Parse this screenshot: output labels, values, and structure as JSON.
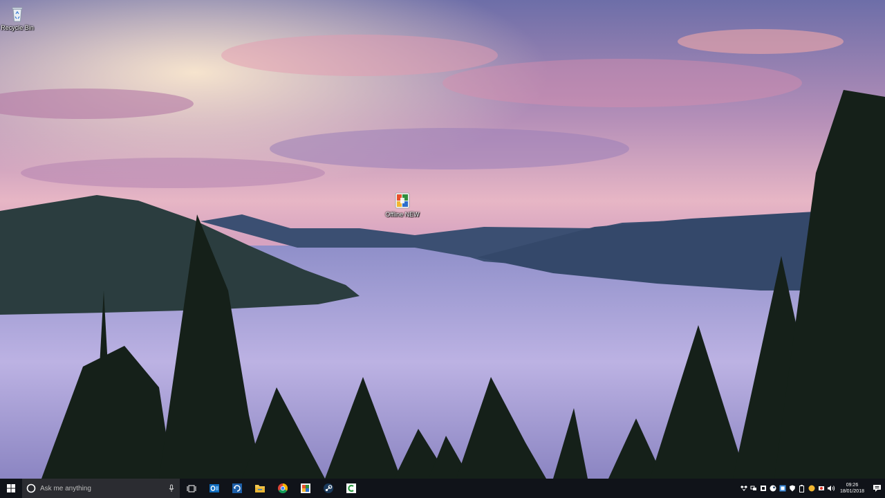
{
  "desktop": {
    "icons": [
      {
        "label": "Recycle Bin",
        "icon": "recycle-bin-icon"
      },
      {
        "label": "Offline NEW",
        "icon": "offline-new-shortcut-icon"
      }
    ]
  },
  "taskbar": {
    "start_icon": "windows-start-icon",
    "search": {
      "placeholder": "Ask me anything",
      "icon": "cortana-circle-icon",
      "mic_icon": "microphone-icon"
    },
    "apps": [
      "task-view-icon",
      "outlook-icon",
      "refresh-app-icon",
      "file-explorer-icon",
      "chrome-icon",
      "app-icon",
      "steam-icon",
      "camtasia-icon"
    ],
    "tray": {
      "icons": [
        "dropbox-icon",
        "network-icon",
        "app-tray-icon",
        "steam-tray-icon",
        "tray-app-icon",
        "shield-icon",
        "battery-icon",
        "power-icon",
        "record-icon",
        "volume-icon"
      ],
      "time": "09:26",
      "date": "18/01/2018"
    },
    "colors": {
      "taskbar": "#101319",
      "search_box": "#2b2c31",
      "accent": "#0078d7"
    }
  }
}
